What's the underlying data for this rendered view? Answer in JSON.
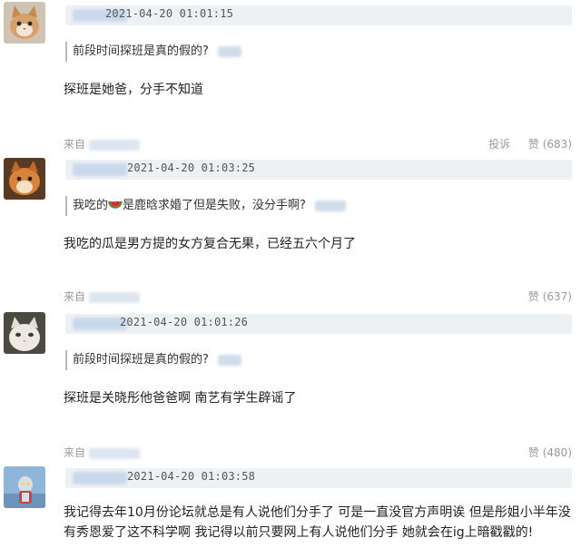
{
  "comments": [
    {
      "timestamp": "2021-04-20 01:01:15",
      "quote_text": "前段时间探班是真的假的?",
      "reply_text": "探班是她爸，分手不知道",
      "source_label": "来自",
      "report_label": "投诉",
      "like_label": "赞 (683)"
    },
    {
      "timestamp": "2021-04-20 01:03:25",
      "quote_pre": "我吃的",
      "quote_post": "是鹿晗求婚了但是失败，没分手啊?",
      "reply_text": "我吃的瓜是男方提的女方复合无果，已经五六个月了",
      "source_label": "来自",
      "like_label": "赞 (637)"
    },
    {
      "timestamp": "2021-04-20 01:01:26",
      "quote_text": "前段时间探班是真的假的?",
      "reply_text": "探班是关晓彤他爸爸啊 南艺有学生辟谣了",
      "source_label": "来自",
      "like_label": "赞 (480)"
    },
    {
      "timestamp": "2021-04-20 01:03:58",
      "reply_line1": "我记得去年10月份论坛就总是有人说他们分手了 可是一直没官方声明诶 但是彤姐小半年没",
      "reply_line2": "有秀恩爱了这不科学啊 我记得以前只要网上有人说他们分手 她就会在ig上暗戳戳的!"
    }
  ],
  "icons": {
    "watermelon": "watermelon-icon",
    "avatars": [
      "cat-avatar",
      "fox-avatar",
      "white-cat-avatar",
      "hero-avatar"
    ]
  },
  "colors": {
    "header_bg": "#eef1f4",
    "muted": "#9a9a9a",
    "text": "#222222"
  }
}
